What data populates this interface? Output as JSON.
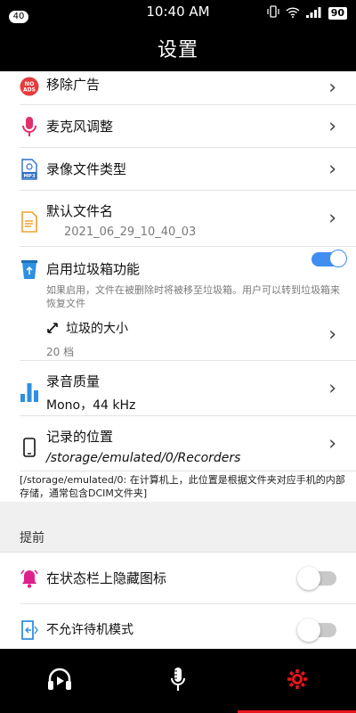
{
  "status_bar": {
    "notification_count": "40",
    "time": "10:40 AM",
    "battery": "90"
  },
  "header": {
    "title": "设置"
  },
  "settings": {
    "remove_ads": {
      "label": "移除广告",
      "icon": "no-ads-icon",
      "icon_text": "NO ADS"
    },
    "mic_adjust": {
      "label": "麦克风调整",
      "icon": "microphone-icon"
    },
    "record_file_type": {
      "label": "录像文件类型",
      "icon": "mp3-file-icon",
      "icon_text": "MP3"
    },
    "default_filename": {
      "label": "默认文件名",
      "value": "2021_06_29_10_40_03",
      "icon": "document-icon"
    },
    "trash": {
      "label": "启用垃圾箱功能",
      "enabled": true,
      "description": "如果启用，文件在被删除时将被移至垃圾箱。用户可以转到垃圾箱来恢复文件",
      "size_label": "垃圾的大小",
      "size_value": "20 档",
      "icon": "trash-icon"
    },
    "audio_quality": {
      "label": "录音质量",
      "value": "Mono，44 kHz",
      "icon": "bar-chart-icon"
    },
    "record_location": {
      "label": "记录的位置",
      "value": "/storage/emulated/0/Recorders",
      "icon": "phone-icon"
    },
    "location_note": "[/storage/emulated/0:  在计算机上，此位置是根据文件夹对应手机的内部存储，通常包含DCIM文件夹]"
  },
  "advanced": {
    "section_title": "提前",
    "hide_status_icon": {
      "label": "在状态栏上隐藏图标",
      "enabled": false,
      "icon": "bell-icon"
    },
    "no_standby": {
      "label": "不允许待机模式",
      "enabled": false,
      "icon": "screen-on-icon"
    }
  },
  "colors": {
    "accent_blue": "#3f8ef0",
    "active_tab_red": "#e8141e",
    "mic_pink": "#e0306c",
    "bell_magenta": "#e0208a"
  },
  "bottom_nav": {
    "tabs": [
      {
        "name": "player",
        "icon": "play-headphones-icon",
        "active": false
      },
      {
        "name": "record",
        "icon": "microphone-icon",
        "active": false
      },
      {
        "name": "settings",
        "icon": "gear-icon",
        "active": true
      }
    ]
  }
}
